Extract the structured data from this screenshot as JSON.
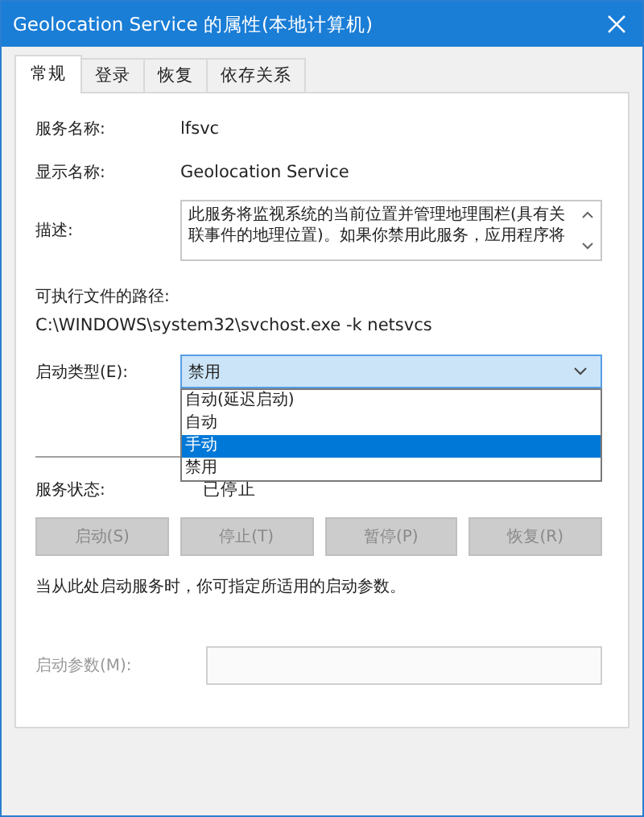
{
  "window": {
    "title": "Geolocation Service 的属性(本地计算机)"
  },
  "tabs": [
    {
      "label": "常规",
      "selected": true
    },
    {
      "label": "登录",
      "selected": false
    },
    {
      "label": "恢复",
      "selected": false
    },
    {
      "label": "依存关系",
      "selected": false
    }
  ],
  "service_name": {
    "label": "服务名称:",
    "value": "lfsvc"
  },
  "display_name": {
    "label": "显示名称:",
    "value": "Geolocation Service"
  },
  "description": {
    "label": "描述:",
    "value": "此服务将监视系统的当前位置并管理地理围栏(具有关联事件的地理位置)。如果你禁用此服务，应用程序将"
  },
  "executable_path": {
    "label": "可执行文件的路径:",
    "value": "C:\\WINDOWS\\system32\\svchost.exe -k netsvcs"
  },
  "startup_type": {
    "label": "启动类型(E):",
    "value": "禁用",
    "expanded": true,
    "options": [
      {
        "label": "自动(延迟启动)",
        "highlighted": false
      },
      {
        "label": "自动",
        "highlighted": false
      },
      {
        "label": "手动",
        "highlighted": true
      },
      {
        "label": "禁用",
        "highlighted": false
      }
    ]
  },
  "service_status": {
    "label": "服务状态:",
    "value": "已停止"
  },
  "buttons": [
    {
      "label": "启动(S)",
      "disabled": true
    },
    {
      "label": "停止(T)",
      "disabled": true
    },
    {
      "label": "暂停(P)",
      "disabled": true
    },
    {
      "label": "恢复(R)",
      "disabled": true
    }
  ],
  "hint": "当从此处启动服务时，你可指定所适用的启动参数。",
  "start_parameters": {
    "label": "启动参数(M):",
    "disabled": true
  }
}
